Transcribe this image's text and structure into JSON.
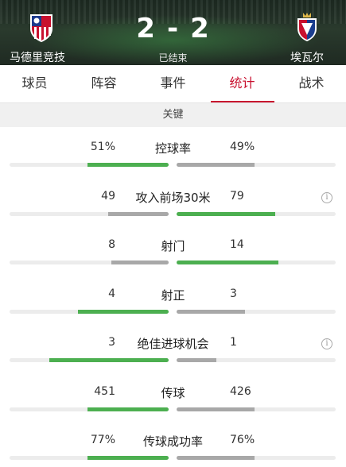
{
  "match": {
    "home_team": "马德里竞技",
    "away_team": "埃瓦尔",
    "home_score": "2",
    "away_score": "2",
    "separator": "-",
    "status": "已结束"
  },
  "tabs": [
    {
      "label": "球员",
      "active": false
    },
    {
      "label": "阵容",
      "active": false
    },
    {
      "label": "事件",
      "active": false
    },
    {
      "label": "统计",
      "active": true
    },
    {
      "label": "战术",
      "active": false
    }
  ],
  "section_title": "关键",
  "colors": {
    "win": "#4caf50",
    "lose": "#a8a8a8",
    "track": "#ececec",
    "accent": "#c8102e"
  },
  "stats": [
    {
      "label": "控球率",
      "home": "51%",
      "away": "49%",
      "home_fraction": 0.51,
      "away_fraction": 0.49,
      "leader": "home",
      "info": false
    },
    {
      "label": "攻入前场30米",
      "home": "49",
      "away": "79",
      "home_fraction": 0.38,
      "away_fraction": 0.62,
      "leader": "away",
      "info": true
    },
    {
      "label": "射门",
      "home": "8",
      "away": "14",
      "home_fraction": 0.36,
      "away_fraction": 0.64,
      "leader": "away",
      "info": false
    },
    {
      "label": "射正",
      "home": "4",
      "away": "3",
      "home_fraction": 0.57,
      "away_fraction": 0.43,
      "leader": "home",
      "info": false
    },
    {
      "label": "绝佳进球机会",
      "home": "3",
      "away": "1",
      "home_fraction": 0.75,
      "away_fraction": 0.25,
      "leader": "home",
      "info": true
    },
    {
      "label": "传球",
      "home": "451",
      "away": "426",
      "home_fraction": 0.51,
      "away_fraction": 0.49,
      "leader": "home",
      "info": false
    },
    {
      "label": "传球成功率",
      "home": "77%",
      "away": "76%",
      "home_fraction": 0.51,
      "away_fraction": 0.49,
      "leader": "home",
      "info": false
    }
  ]
}
